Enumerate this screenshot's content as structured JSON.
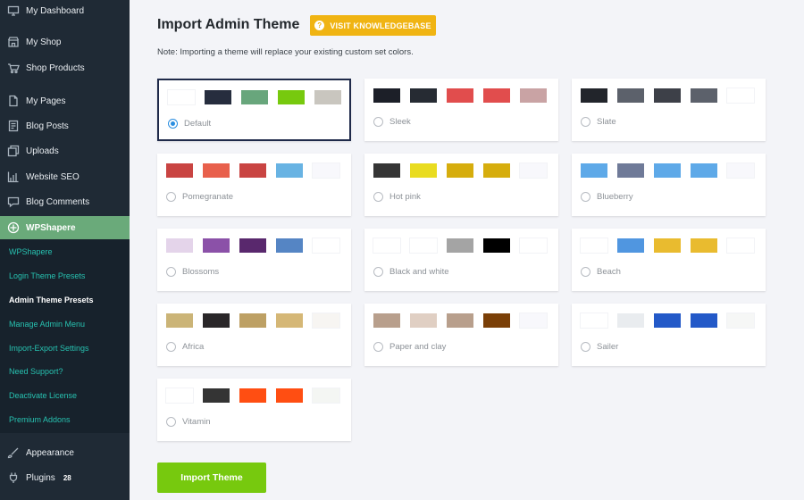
{
  "sidebar": {
    "items": [
      {
        "label": "My Dashboard",
        "icon": "dashboard-icon"
      },
      {
        "label": "My Shop",
        "icon": "shop-icon"
      },
      {
        "label": "Shop Products",
        "icon": "products-icon"
      },
      {
        "label": "My Pages",
        "icon": "pages-icon"
      },
      {
        "label": "Blog Posts",
        "icon": "posts-icon"
      },
      {
        "label": "Uploads",
        "icon": "uploads-icon"
      },
      {
        "label": "Website SEO",
        "icon": "seo-icon"
      },
      {
        "label": "Blog Comments",
        "icon": "comments-icon"
      },
      {
        "label": "WPShapere",
        "icon": "wpshapere-icon"
      }
    ],
    "submenu": [
      {
        "label": "WPShapere"
      },
      {
        "label": "Login Theme Presets"
      },
      {
        "label": "Admin Theme Presets"
      },
      {
        "label": "Manage Admin Menu"
      },
      {
        "label": "Import-Export Settings"
      },
      {
        "label": "Need Support?"
      },
      {
        "label": "Deactivate License"
      },
      {
        "label": "Premium Addons"
      }
    ],
    "bottom": [
      {
        "label": "Appearance",
        "icon": "appearance-icon"
      },
      {
        "label": "Plugins",
        "icon": "plugins-icon",
        "badge": "28"
      }
    ],
    "colors": {
      "bg": "#1f2a35",
      "active": "#6aaa7a",
      "submenu_text": "#27c1b0"
    }
  },
  "main": {
    "title": "Import Admin Theme",
    "kb_button": "VISIT KNOWLEDGEBASE",
    "note": "Note: Importing a theme will replace your existing custom set colors.",
    "import_button": "Import Theme"
  },
  "themes": [
    {
      "name": "Default",
      "selected": true,
      "colors": [
        "#ffffff",
        "#262d3e",
        "#68a67c",
        "#77c90e",
        "#c9c6bf"
      ]
    },
    {
      "name": "Sleek",
      "selected": false,
      "colors": [
        "#1c1f28",
        "#262b33",
        "#e14d4d",
        "#e14d4d",
        "#c9a3a4"
      ]
    },
    {
      "name": "Slate",
      "selected": false,
      "colors": [
        "#22252b",
        "#5c616b",
        "#3d4048",
        "#5c616b",
        "#ffffff"
      ]
    },
    {
      "name": "Pomegranate",
      "selected": false,
      "colors": [
        "#c94442",
        "#e8604c",
        "#c94442",
        "#68b3e3",
        "#f8f8fc"
      ]
    },
    {
      "name": "Hot pink",
      "selected": false,
      "colors": [
        "#353535",
        "#e9dc20",
        "#d6ad0d",
        "#d6ad0d",
        "#f8f8fc"
      ]
    },
    {
      "name": "Blueberry",
      "selected": false,
      "colors": [
        "#5ea9e8",
        "#6f7a98",
        "#5ea9e8",
        "#5ea9e8",
        "#f8f8fc"
      ]
    },
    {
      "name": "Blossoms",
      "selected": false,
      "colors": [
        "#e4d4ea",
        "#8b51a8",
        "#59286d",
        "#5585c4",
        "#ffffff"
      ]
    },
    {
      "name": "Black and white",
      "selected": false,
      "colors": [
        "#ffffff",
        "#ffffff",
        "#a4a4a4",
        "#000000",
        "#ffffff"
      ]
    },
    {
      "name": "Beach",
      "selected": false,
      "colors": [
        "#ffffff",
        "#5096e0",
        "#e9bb2f",
        "#e9bb2f",
        "#ffffff"
      ]
    },
    {
      "name": "Africa",
      "selected": false,
      "colors": [
        "#cbb477",
        "#2a2729",
        "#bda064",
        "#d5b776",
        "#f7f5f2"
      ]
    },
    {
      "name": "Paper and clay",
      "selected": false,
      "colors": [
        "#b89f8c",
        "#e0cfc3",
        "#b89f8c",
        "#7a3f07",
        "#f8f8fc"
      ]
    },
    {
      "name": "Sailer",
      "selected": false,
      "colors": [
        "#ffffff",
        "#e9ecef",
        "#2359c8",
        "#2359c8",
        "#f6f7f6"
      ]
    },
    {
      "name": "Vitamin",
      "selected": false,
      "colors": [
        "#ffffff",
        "#343434",
        "#ff4e12",
        "#ff4e12",
        "#f4f6f3"
      ]
    }
  ]
}
